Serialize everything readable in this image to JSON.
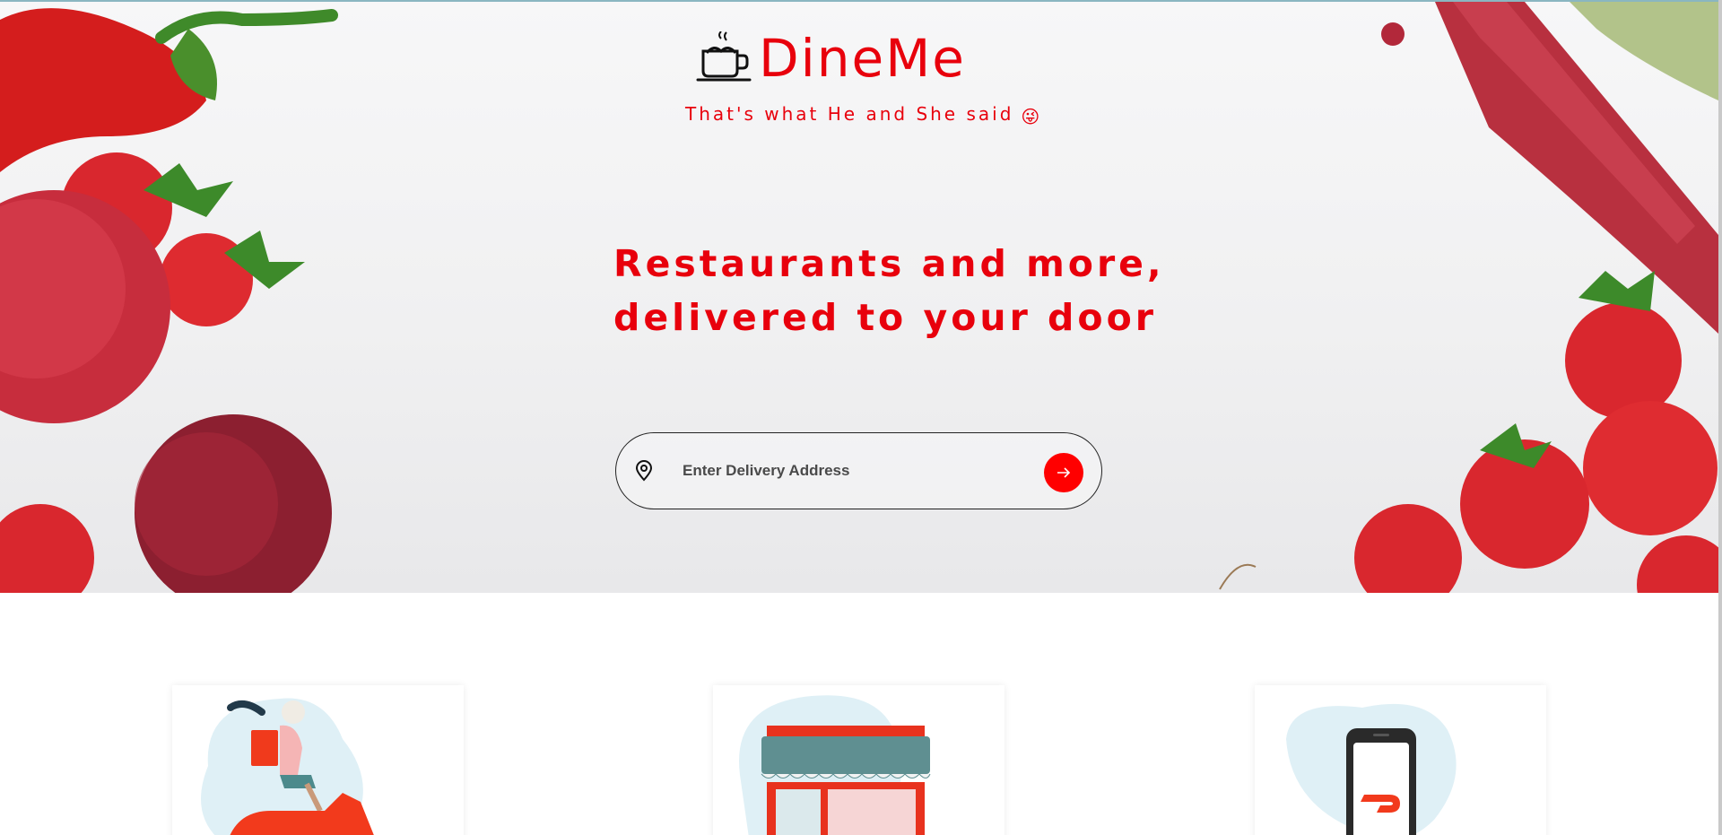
{
  "brand": {
    "name": "DineMe",
    "tagline": "That's what He and She said",
    "tagline_emoji": "😜"
  },
  "hero": {
    "headline_line1": "Restaurants and more,",
    "headline_line2": "delivered to your door"
  },
  "search": {
    "placeholder": "Enter Delivery Address",
    "value": "",
    "submit_label": "→"
  },
  "cards": [
    {
      "illustration": "scooter-courier"
    },
    {
      "illustration": "storefront"
    },
    {
      "illustration": "mobile-app"
    }
  ],
  "colors": {
    "brand_red": "#e8000c",
    "button_red": "#ff0000"
  }
}
